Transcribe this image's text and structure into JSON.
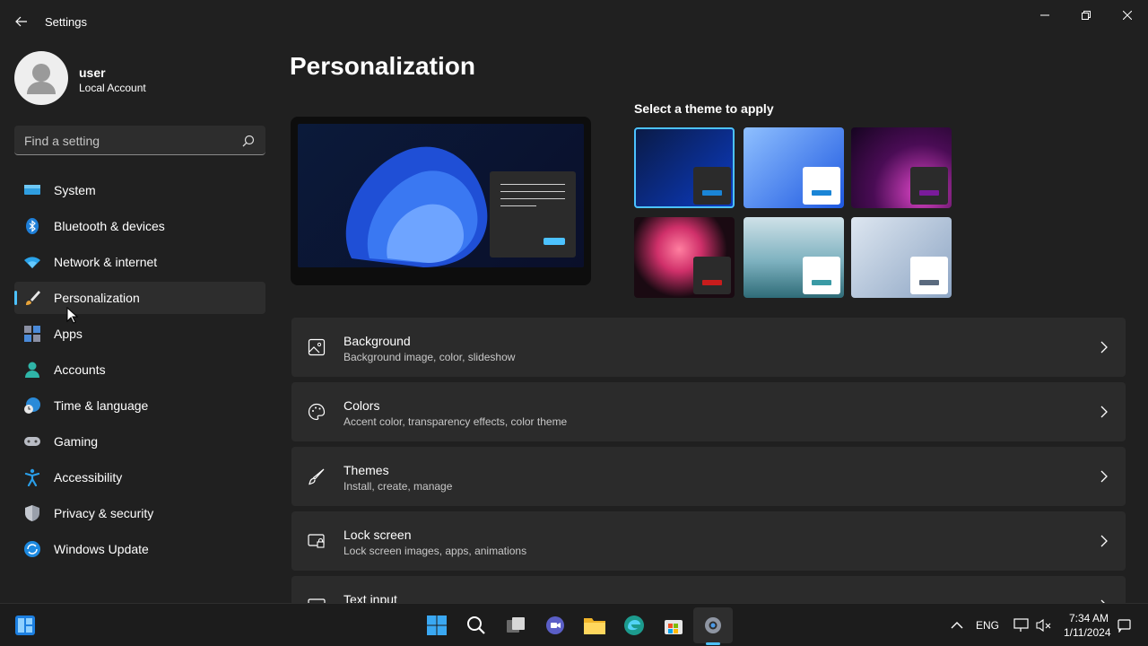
{
  "window": {
    "title": "Settings"
  },
  "user": {
    "name": "user",
    "account_type": "Local Account"
  },
  "search": {
    "placeholder": "Find a setting"
  },
  "sidebar": {
    "items": [
      {
        "label": "System",
        "icon": "system-icon"
      },
      {
        "label": "Bluetooth & devices",
        "icon": "bluetooth-icon"
      },
      {
        "label": "Network & internet",
        "icon": "wifi-icon"
      },
      {
        "label": "Personalization",
        "icon": "brush-icon",
        "active": true
      },
      {
        "label": "Apps",
        "icon": "apps-icon"
      },
      {
        "label": "Accounts",
        "icon": "person-icon"
      },
      {
        "label": "Time & language",
        "icon": "globe-clock-icon"
      },
      {
        "label": "Gaming",
        "icon": "gamepad-icon"
      },
      {
        "label": "Accessibility",
        "icon": "accessibility-icon"
      },
      {
        "label": "Privacy & security",
        "icon": "shield-icon"
      },
      {
        "label": "Windows Update",
        "icon": "update-icon"
      }
    ]
  },
  "main": {
    "title": "Personalization",
    "themes_label": "Select a theme to apply",
    "themes": [
      {
        "name": "windows-dark",
        "selected": true
      },
      {
        "name": "windows-light"
      },
      {
        "name": "glow"
      },
      {
        "name": "captured-motion"
      },
      {
        "name": "sunrise"
      },
      {
        "name": "flow"
      }
    ],
    "cards": [
      {
        "title": "Background",
        "subtitle": "Background image, color, slideshow",
        "icon": "image-icon"
      },
      {
        "title": "Colors",
        "subtitle": "Accent color, transparency effects, color theme",
        "icon": "palette-icon"
      },
      {
        "title": "Themes",
        "subtitle": "Install, create, manage",
        "icon": "brush-icon"
      },
      {
        "title": "Lock screen",
        "subtitle": "Lock screen images, apps, animations",
        "icon": "lock-screen-icon"
      },
      {
        "title": "Text input",
        "subtitle": "",
        "icon": "keyboard-icon"
      }
    ]
  },
  "taskbar": {
    "language": "ENG",
    "time": "7:34 AM",
    "date": "1/11/2024"
  },
  "colors": {
    "accent": "#4cc2ff",
    "background": "#202020",
    "card": "#2b2b2b"
  }
}
